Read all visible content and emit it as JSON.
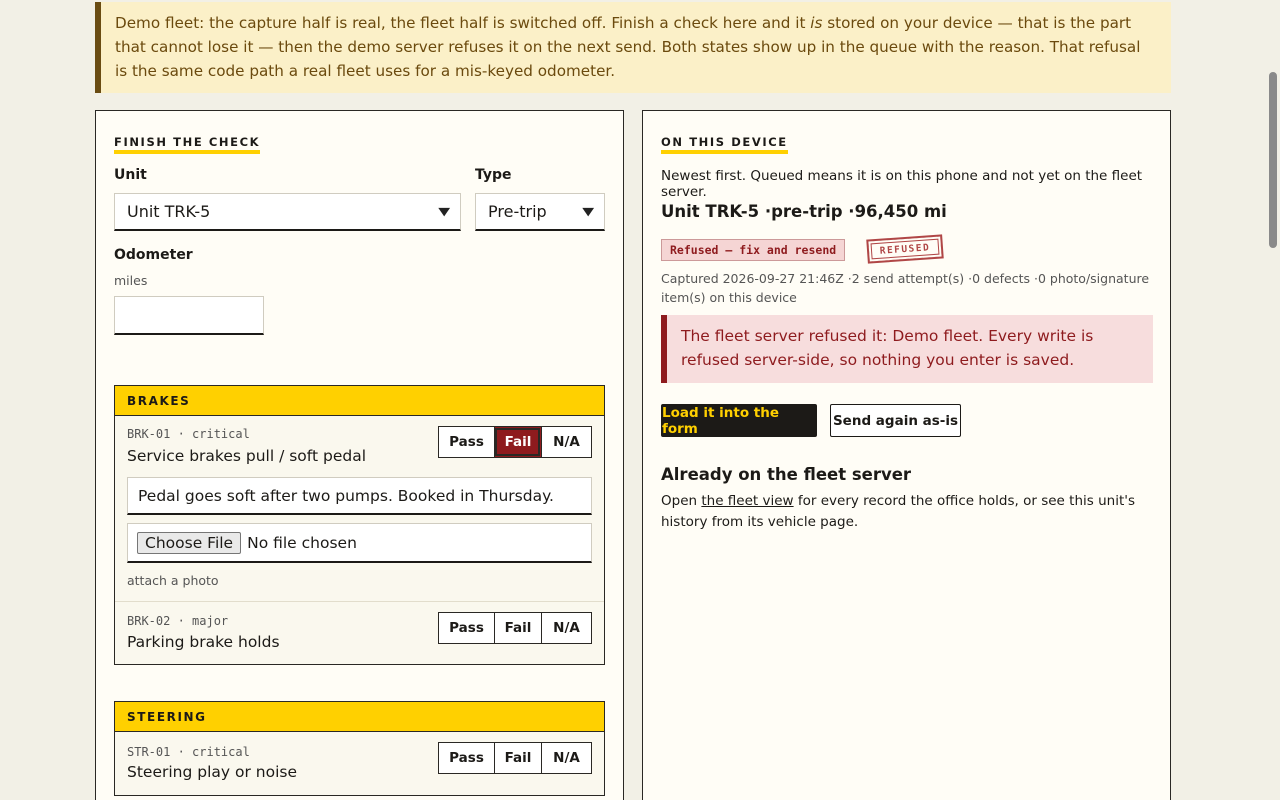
{
  "banner": {
    "part1": "Demo fleet: the capture half is real, the fleet half is switched off. Finish a check here and it ",
    "emph": "is",
    "part2": " stored on your device — that is the part that cannot lose it — then the demo server refuses it on the next send. Both states show up in the queue with the reason. That refusal is the same code path a real fleet uses for a mis-keyed odometer."
  },
  "form": {
    "title": "FINISH THE CHECK",
    "unit_label": "Unit",
    "unit_value": "Unit TRK-5",
    "type_label": "Type",
    "type_value": "Pre-trip",
    "odometer_label": "Odometer",
    "odometer_unit": "miles",
    "odometer_value": ""
  },
  "groups": [
    {
      "title": "BRAKES",
      "items": [
        {
          "code": "BRK-01 · critical",
          "name": "Service brakes pull / soft pedal",
          "selected": "Fail",
          "note": "Pedal goes soft after two pumps. Booked in Thursday.",
          "file_button": "Choose File",
          "file_status": "No file chosen",
          "file_hint": "attach a photo"
        },
        {
          "code": "BRK-02 · major",
          "name": "Parking brake holds",
          "selected": ""
        }
      ]
    },
    {
      "title": "STEERING",
      "items": [
        {
          "code": "STR-01 · critical",
          "name": "Steering play or noise",
          "selected": ""
        }
      ]
    }
  ],
  "seg_labels": {
    "pass": "Pass",
    "fail": "Fail",
    "na": "N/A"
  },
  "device": {
    "title": "ON THIS DEVICE",
    "intro": "Newest first. Queued means it is on this phone and not yet on the fleet server.",
    "record_title": "Unit TRK-5 ·pre-trip ·96,450 mi",
    "status_chip": "Refused — fix and resend",
    "stamp": "REFUSED",
    "meta": "Captured 2026-09-27 21:46Z ·2 send attempt(s) ·0 defects ·0 photo/signature item(s) on this device",
    "refusal": "The fleet server refused it: Demo fleet. Every write is refused server-side, so nothing you enter is saved.",
    "load_button": "Load it into the form",
    "send_button": "Send again as-is",
    "server_heading": "Already on the fleet server",
    "server_text_1": "Open ",
    "server_link": "the fleet view",
    "server_text_2": " for every record the office holds, or see this unit's history from its vehicle page."
  },
  "colors": {
    "accent": "#ffd000",
    "refused": "#8e1b1e",
    "banner_bg": "#fbf0c8"
  }
}
